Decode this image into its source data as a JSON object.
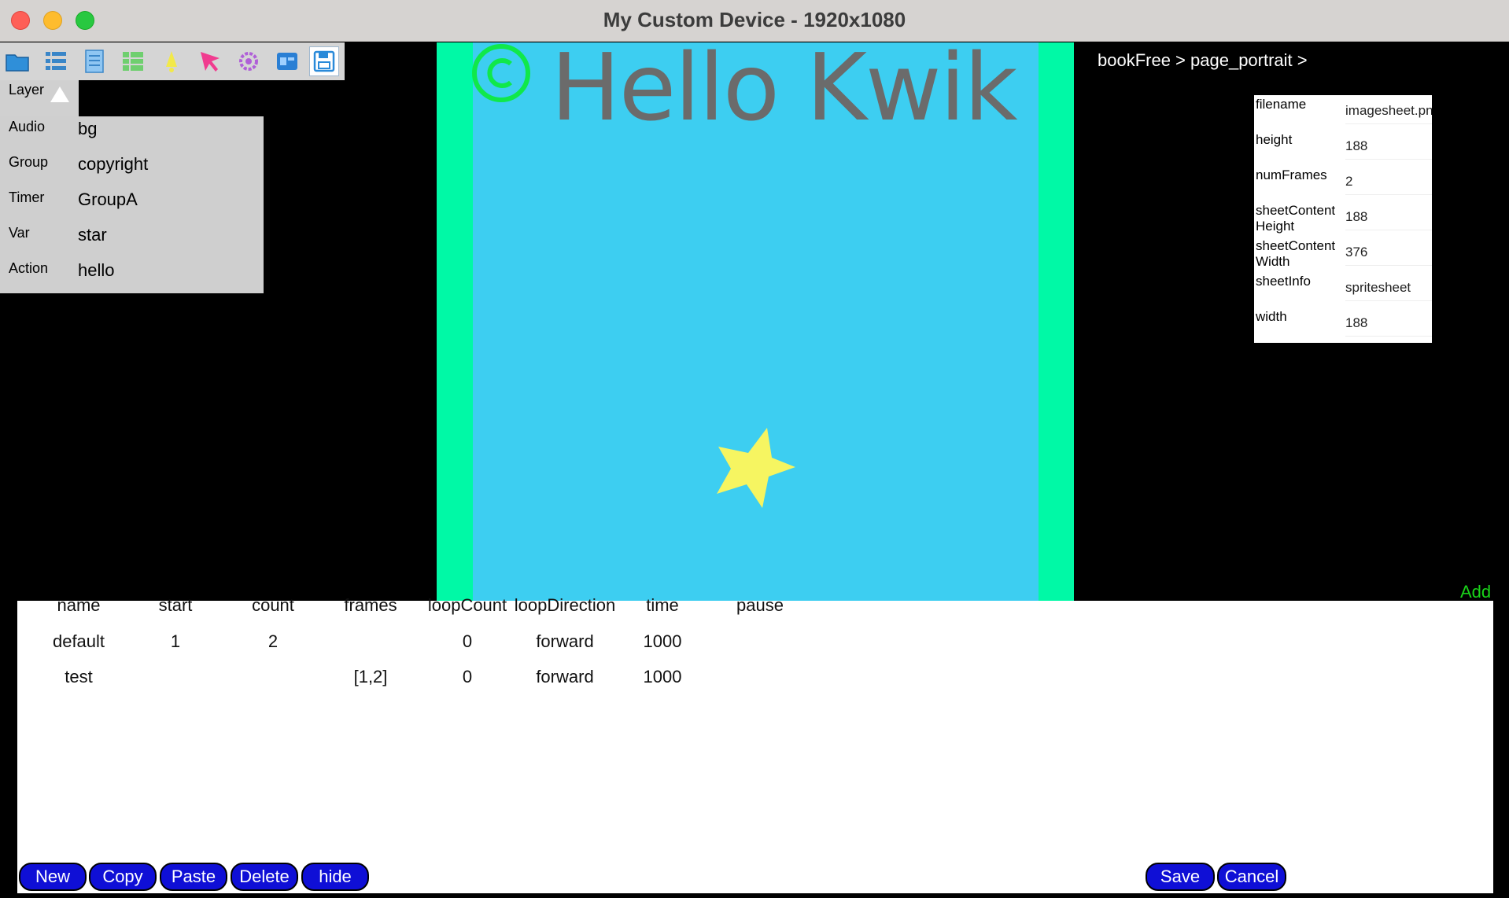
{
  "window": {
    "title": "My Custom Device - 1920x1080"
  },
  "toolbar": {
    "icons": [
      "folder-icon",
      "list-icon",
      "page-icon",
      "grid-icon",
      "bell-icon",
      "cursor-icon",
      "gear-icon",
      "layout-icon",
      "save-icon"
    ]
  },
  "side_panel": {
    "tab_label": "Layer",
    "categories": [
      "Audio",
      "Group",
      "Timer",
      "Var",
      "Action"
    ],
    "layers": [
      "bg",
      "copyright",
      "GroupA",
      "star",
      "hello"
    ]
  },
  "stage": {
    "text": "Hello Kwik",
    "background_color": "#3dcef1",
    "edge_color": "#00f9a6"
  },
  "breadcrumb": "bookFree > page_portrait >",
  "properties": [
    {
      "key": "filename",
      "value": "imagesheet.png"
    },
    {
      "key": "height",
      "value": "188"
    },
    {
      "key": "numFrames",
      "value": "2"
    },
    {
      "key": "sheetContent Height",
      "value": "188"
    },
    {
      "key": "sheetContent Width",
      "value": "376"
    },
    {
      "key": "sheetInfo",
      "value": "spritesheet"
    },
    {
      "key": "width",
      "value": "188"
    }
  ],
  "add_label": "Add",
  "sequence_table": {
    "columns": [
      "name",
      "start",
      "count",
      "frames",
      "loopCount",
      "loopDirection",
      "time",
      "pause"
    ],
    "rows": [
      [
        "default",
        "1",
        "2",
        "",
        "0",
        "forward",
        "1000",
        ""
      ],
      [
        "test",
        "",
        "",
        "[1,2]",
        "0",
        "forward",
        "1000",
        ""
      ]
    ]
  },
  "buttons": {
    "new": "New",
    "copy": "Copy",
    "paste": "Paste",
    "delete": "Delete",
    "hide": "hide",
    "save": "Save",
    "cancel": "Cancel"
  }
}
